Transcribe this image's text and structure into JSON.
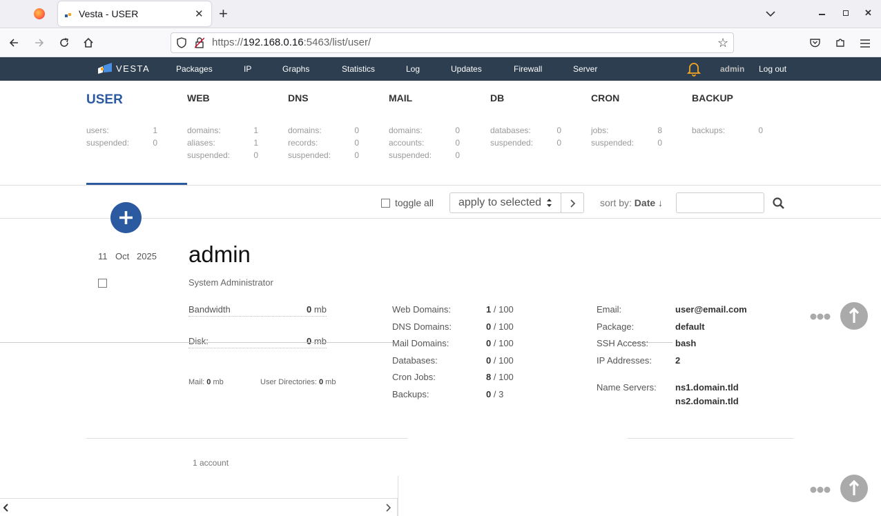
{
  "browser": {
    "tab_title": "Vesta - USER",
    "url_prefix": "https://",
    "url_host": "192.168.0.16",
    "url_rest": ":5463/list/user/"
  },
  "nav": {
    "logo": "VESTA",
    "items": [
      "Packages",
      "IP",
      "Graphs",
      "Statistics",
      "Log",
      "Updates",
      "Firewall",
      "Server"
    ],
    "user": "admin",
    "logout": "Log out"
  },
  "stats": [
    {
      "title": "USER",
      "rows": [
        [
          "users:",
          "1"
        ],
        [
          "suspended:",
          "0"
        ]
      ]
    },
    {
      "title": "WEB",
      "rows": [
        [
          "domains:",
          "1"
        ],
        [
          "aliases:",
          "1"
        ],
        [
          "suspended:",
          "0"
        ]
      ]
    },
    {
      "title": "DNS",
      "rows": [
        [
          "domains:",
          "0"
        ],
        [
          "records:",
          "0"
        ],
        [
          "suspended:",
          "0"
        ]
      ]
    },
    {
      "title": "MAIL",
      "rows": [
        [
          "domains:",
          "0"
        ],
        [
          "accounts:",
          "0"
        ],
        [
          "suspended:",
          "0"
        ]
      ]
    },
    {
      "title": "DB",
      "rows": [
        [
          "databases:",
          "0"
        ],
        [
          "suspended:",
          "0"
        ]
      ]
    },
    {
      "title": "CRON",
      "rows": [
        [
          "jobs:",
          "8"
        ],
        [
          "suspended:",
          "0"
        ]
      ]
    },
    {
      "title": "BACKUP",
      "rows": [
        [
          "backups:",
          "0"
        ]
      ]
    }
  ],
  "toolbar": {
    "toggle_all": "toggle all",
    "apply": "apply to selected",
    "sort_prefix": "sort by:",
    "sort_value": "Date ↓"
  },
  "user": {
    "day": "11",
    "month": "Oct",
    "year": "2025",
    "name": "admin",
    "role": "System Administrator",
    "bandwidth_label": "Bandwidth",
    "bandwidth_value": "0",
    "bandwidth_unit": "mb",
    "disk_label": "Disk:",
    "disk_value": "0",
    "disk_unit": "mb",
    "mail_label": "Mail:",
    "mail_value": "0",
    "mail_unit": "mb",
    "userdir_label": "User Directories:",
    "userdir_value": "0",
    "userdir_unit": "mb",
    "limits": [
      {
        "label": "Web Domains:",
        "used": "1",
        "max": "/ 100"
      },
      {
        "label": "DNS Domains:",
        "used": "0",
        "max": "/ 100"
      },
      {
        "label": "Mail Domains:",
        "used": "0",
        "max": "/ 100"
      },
      {
        "label": "Databases:",
        "used": "0",
        "max": "/ 100"
      },
      {
        "label": "Cron Jobs:",
        "used": "8",
        "max": "/ 100"
      },
      {
        "label": "Backups:",
        "used": "0",
        "max": "/ 3"
      }
    ],
    "info": [
      {
        "label": "Email:",
        "value": "user@email.com"
      },
      {
        "label": "Package:",
        "value": "default"
      },
      {
        "label": "SSH Access:",
        "value": "bash"
      },
      {
        "label": "IP Addresses:",
        "value": "2"
      }
    ],
    "ns_label": "Name Servers:",
    "ns": [
      "ns1.domain.tld",
      "ns2.domain.tld"
    ]
  },
  "footer": {
    "count": "1 account"
  },
  "colors": {
    "accent": "#2c5aa0",
    "nav_bg": "#2c3e50",
    "bell": "#f5a623"
  }
}
